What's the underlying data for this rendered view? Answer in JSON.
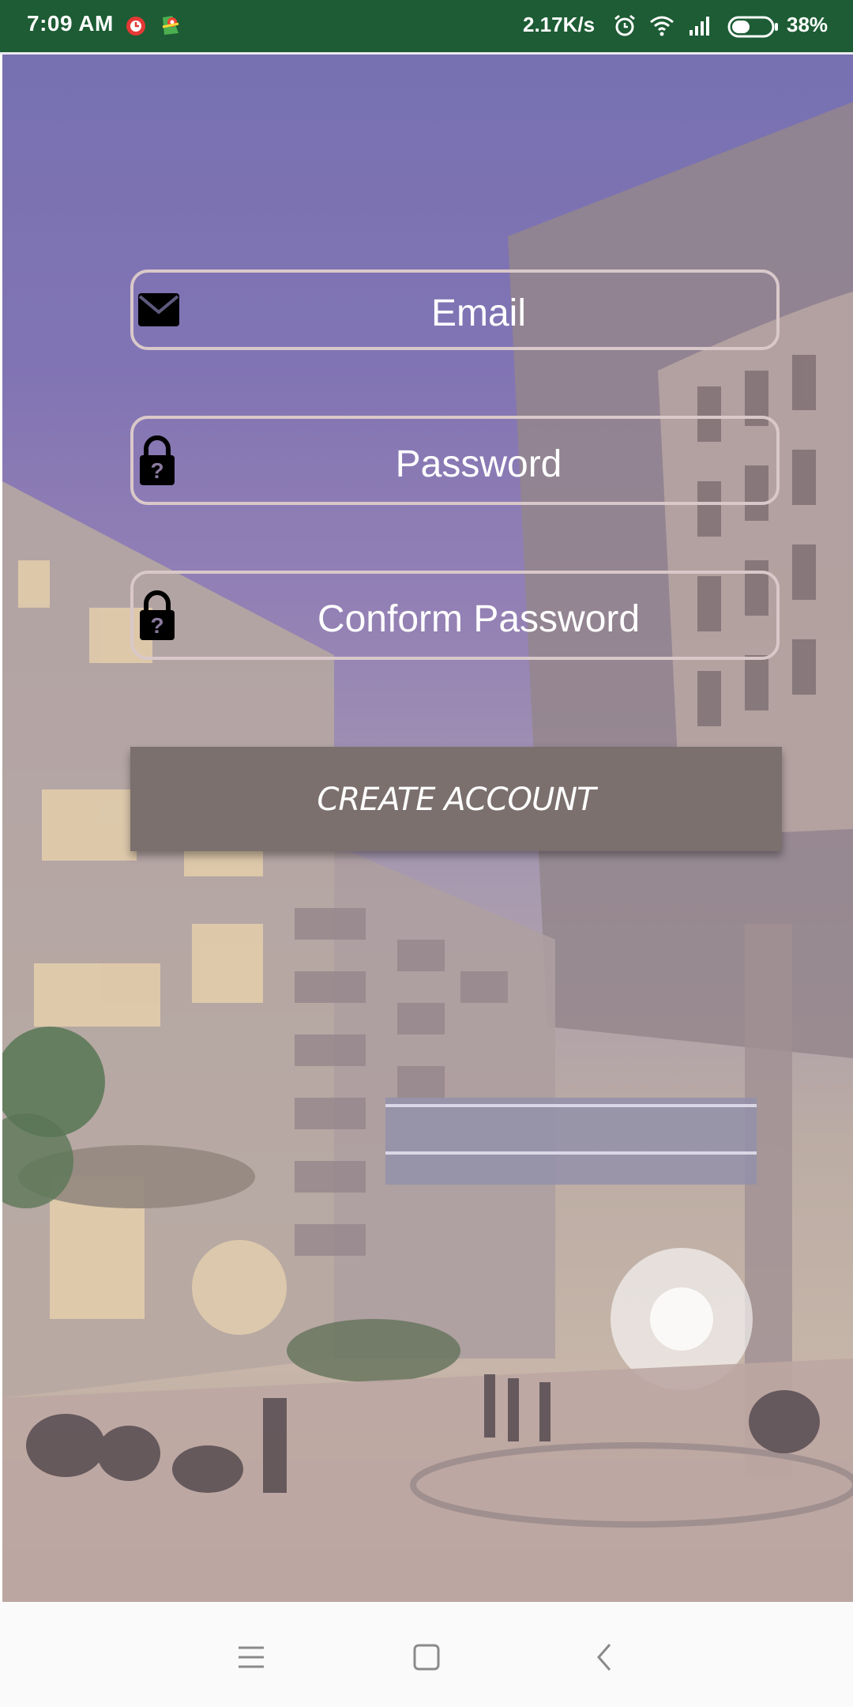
{
  "status_bar": {
    "time": "7:09 AM",
    "speed": "2.17K/s",
    "battery": "38%",
    "icons": [
      "alarm-app-icon",
      "maps-icon",
      "alarm-clock-icon",
      "wifi-icon",
      "signal-icon",
      "battery-icon"
    ]
  },
  "form": {
    "email_placeholder": "Email",
    "password_placeholder": "Password",
    "confirm_password_placeholder": "Conform Password",
    "create_button_label": "CREATE ACCOUNT"
  },
  "nav": {
    "icons": [
      "menu-icon",
      "home-icon",
      "back-icon"
    ]
  },
  "colors": {
    "status_bar": "#1d5c34",
    "field_border": "#d9c8c9",
    "button": "#7b706e"
  }
}
